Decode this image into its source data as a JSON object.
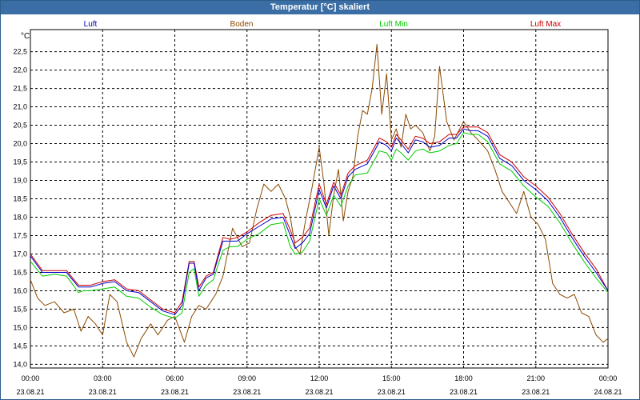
{
  "window": {
    "title": "Temperatur [°C] skaliert"
  },
  "chart_data": {
    "type": "line",
    "title": "Temperatur [°C] skaliert",
    "ylabel": "°C",
    "xlabel": "",
    "ylim": [
      13.9,
      23.1
    ],
    "xlim": [
      0,
      24
    ],
    "grid": true,
    "legend_position": "top",
    "y_ticks": [
      14.0,
      14.5,
      15.0,
      15.5,
      16.0,
      16.5,
      17.0,
      17.5,
      18.0,
      18.5,
      19.0,
      19.5,
      20.0,
      20.5,
      21.0,
      21.5,
      22.0,
      22.5
    ],
    "y_tick_labels": [
      "14,0",
      "14,5",
      "15,0",
      "15,5",
      "16,0",
      "16,5",
      "17,0",
      "17,5",
      "18,0",
      "18,5",
      "19,0",
      "19,5",
      "20,0",
      "20,5",
      "21,0",
      "21,5",
      "22,0",
      "22,5"
    ],
    "x_ticks": [
      {
        "x": 0,
        "time": "00:00",
        "date": "23.08.21"
      },
      {
        "x": 3,
        "time": "03:00",
        "date": "23.08.21"
      },
      {
        "x": 6,
        "time": "06:00",
        "date": "23.08.21"
      },
      {
        "x": 9,
        "time": "09:00",
        "date": "23.08.21"
      },
      {
        "x": 12,
        "time": "12:00",
        "date": "23.08.21"
      },
      {
        "x": 15,
        "time": "15:00",
        "date": "23.08.21"
      },
      {
        "x": 18,
        "time": "18:00",
        "date": "23.08.21"
      },
      {
        "x": 21,
        "time": "21:00",
        "date": "23.08.21"
      },
      {
        "x": 24,
        "time": "00:00",
        "date": "24.08.21"
      }
    ],
    "series": [
      {
        "name": "Luft",
        "color": "#0000cc",
        "x": [
          0,
          0.5,
          1,
          1.5,
          2,
          2.2,
          2.5,
          3,
          3.5,
          4,
          4.5,
          5,
          5.5,
          6,
          6.3,
          6.6,
          6.8,
          7,
          7.3,
          7.6,
          8,
          8.3,
          8.6,
          9,
          9.5,
          10,
          10.5,
          10.8,
          11,
          11.3,
          11.6,
          12,
          12.3,
          12.6,
          12.9,
          13.2,
          13.5,
          14,
          14.5,
          14.8,
          15,
          15.2,
          15.4,
          15.7,
          16,
          16.3,
          16.6,
          17,
          17.4,
          17.7,
          18,
          18.3,
          18.6,
          19,
          19.5,
          20,
          20.5,
          21,
          21.5,
          22,
          22.5,
          23,
          23.5,
          24
        ],
        "values": [
          16.95,
          16.5,
          16.5,
          16.5,
          16.1,
          16.1,
          16.1,
          16.2,
          16.25,
          16.0,
          15.95,
          15.7,
          15.45,
          15.35,
          15.6,
          16.75,
          16.75,
          16.0,
          16.35,
          16.45,
          17.35,
          17.35,
          17.35,
          17.55,
          17.75,
          17.95,
          18.0,
          17.5,
          17.15,
          17.3,
          17.55,
          18.75,
          18.25,
          18.85,
          18.5,
          19.1,
          19.3,
          19.45,
          20.05,
          19.95,
          19.8,
          20.15,
          20.0,
          19.75,
          20.1,
          20.05,
          19.9,
          19.95,
          20.15,
          20.15,
          20.4,
          20.35,
          20.35,
          20.2,
          19.6,
          19.4,
          19.0,
          18.75,
          18.45,
          18.0,
          17.45,
          16.95,
          16.5,
          16.0
        ]
      },
      {
        "name": "Boden",
        "color": "#8b4a00",
        "x": [
          0,
          0.3,
          0.6,
          1,
          1.4,
          1.8,
          2.1,
          2.4,
          2.7,
          3.0,
          3.3,
          3.6,
          4.0,
          4.3,
          4.6,
          5.0,
          5.3,
          5.7,
          6.0,
          6.4,
          6.7,
          7.0,
          7.3,
          7.7,
          8.0,
          8.4,
          8.8,
          9.1,
          9.4,
          9.7,
          10.0,
          10.3,
          10.6,
          10.8,
          11.0,
          11.2,
          11.4,
          11.7,
          12.0,
          12.2,
          12.4,
          12.6,
          12.8,
          13.0,
          13.2,
          13.4,
          13.6,
          13.8,
          14.0,
          14.2,
          14.4,
          14.6,
          14.8,
          15.0,
          15.2,
          15.4,
          15.6,
          15.8,
          16.0,
          16.3,
          16.6,
          16.8,
          17.0,
          17.3,
          17.6,
          18.0,
          18.3,
          18.6,
          19.0,
          19.3,
          19.6,
          19.9,
          20.2,
          20.5,
          20.8,
          21.1,
          21.4,
          21.7,
          22.0,
          22.3,
          22.6,
          22.9,
          23.2,
          23.5,
          23.8,
          24
        ],
        "values": [
          16.3,
          15.8,
          15.6,
          15.7,
          15.4,
          15.5,
          14.9,
          15.3,
          15.1,
          14.8,
          15.9,
          15.7,
          14.6,
          14.2,
          14.7,
          15.1,
          14.8,
          15.2,
          15.3,
          14.6,
          15.3,
          15.6,
          15.5,
          15.9,
          16.4,
          17.7,
          17.2,
          17.3,
          18.2,
          18.9,
          18.7,
          18.9,
          18.5,
          18.0,
          17.2,
          17.0,
          17.8,
          18.8,
          19.9,
          18.9,
          17.5,
          18.6,
          19.3,
          17.9,
          18.7,
          19.1,
          20.2,
          20.9,
          20.8,
          21.5,
          22.7,
          20.8,
          21.9,
          20.1,
          20.4,
          19.9,
          20.8,
          20.4,
          20.5,
          20.3,
          19.8,
          20.2,
          22.1,
          20.6,
          20.1,
          20.6,
          20.3,
          20.1,
          19.8,
          19.3,
          18.7,
          18.4,
          18.1,
          18.7,
          18.0,
          17.8,
          17.4,
          16.2,
          15.9,
          15.8,
          15.9,
          15.4,
          15.3,
          14.8,
          14.6,
          14.7
        ]
      },
      {
        "name": "Luft Min",
        "color": "#00cc00",
        "x": [
          0,
          0.5,
          1,
          1.5,
          2,
          2.2,
          2.5,
          3,
          3.5,
          4,
          4.5,
          5,
          5.5,
          6,
          6.3,
          6.6,
          6.8,
          7,
          7.3,
          7.6,
          8,
          8.3,
          8.6,
          9,
          9.5,
          10,
          10.5,
          10.8,
          11,
          11.3,
          11.6,
          12,
          12.3,
          12.6,
          12.9,
          13.2,
          13.5,
          14,
          14.5,
          14.8,
          15,
          15.2,
          15.4,
          15.7,
          16,
          16.3,
          16.6,
          17,
          17.4,
          17.7,
          18,
          18.3,
          18.6,
          19,
          19.5,
          20,
          20.5,
          21,
          21.5,
          22,
          22.5,
          23,
          23.5,
          24
        ],
        "values": [
          16.8,
          16.4,
          16.45,
          16.4,
          15.95,
          16.0,
          16.0,
          16.05,
          16.1,
          15.85,
          15.8,
          15.55,
          15.35,
          15.25,
          15.4,
          16.5,
          16.6,
          15.85,
          16.15,
          16.3,
          17.1,
          17.2,
          17.2,
          17.4,
          17.55,
          17.8,
          17.85,
          17.2,
          17.0,
          17.05,
          17.35,
          18.5,
          18.05,
          18.6,
          18.3,
          18.85,
          19.15,
          19.2,
          19.8,
          19.75,
          19.55,
          19.85,
          19.75,
          19.55,
          19.8,
          19.85,
          19.75,
          19.8,
          19.95,
          20.0,
          20.3,
          20.25,
          20.25,
          20.05,
          19.45,
          19.25,
          18.85,
          18.55,
          18.3,
          17.85,
          17.3,
          16.8,
          16.35,
          15.95
        ]
      },
      {
        "name": "Luft Max",
        "color": "#cc0000",
        "x": [
          0,
          0.5,
          1,
          1.5,
          2,
          2.2,
          2.5,
          3,
          3.5,
          4,
          4.5,
          5,
          5.5,
          6,
          6.3,
          6.6,
          6.8,
          7,
          7.3,
          7.6,
          8,
          8.3,
          8.6,
          9,
          9.5,
          10,
          10.5,
          10.8,
          11,
          11.3,
          11.6,
          12,
          12.3,
          12.6,
          12.9,
          13.2,
          13.5,
          14,
          14.5,
          14.8,
          15,
          15.2,
          15.4,
          15.7,
          16,
          16.3,
          16.6,
          17,
          17.4,
          17.7,
          18,
          18.3,
          18.6,
          19,
          19.5,
          20,
          20.5,
          21,
          21.5,
          22,
          22.5,
          23,
          23.5,
          24
        ],
        "values": [
          17.0,
          16.55,
          16.55,
          16.55,
          16.15,
          16.15,
          16.15,
          16.25,
          16.3,
          16.05,
          16.0,
          15.75,
          15.5,
          15.4,
          15.7,
          16.8,
          16.8,
          16.1,
          16.4,
          16.5,
          17.45,
          17.4,
          17.45,
          17.6,
          17.85,
          18.05,
          18.1,
          17.65,
          17.3,
          17.45,
          17.7,
          18.9,
          18.35,
          18.95,
          18.6,
          19.2,
          19.4,
          19.55,
          20.15,
          20.05,
          19.9,
          20.25,
          20.1,
          19.85,
          20.2,
          20.15,
          20.0,
          20.05,
          20.25,
          20.25,
          20.45,
          20.45,
          20.45,
          20.3,
          19.7,
          19.5,
          19.1,
          18.85,
          18.55,
          18.1,
          17.55,
          17.05,
          16.6,
          16.0
        ]
      }
    ]
  }
}
